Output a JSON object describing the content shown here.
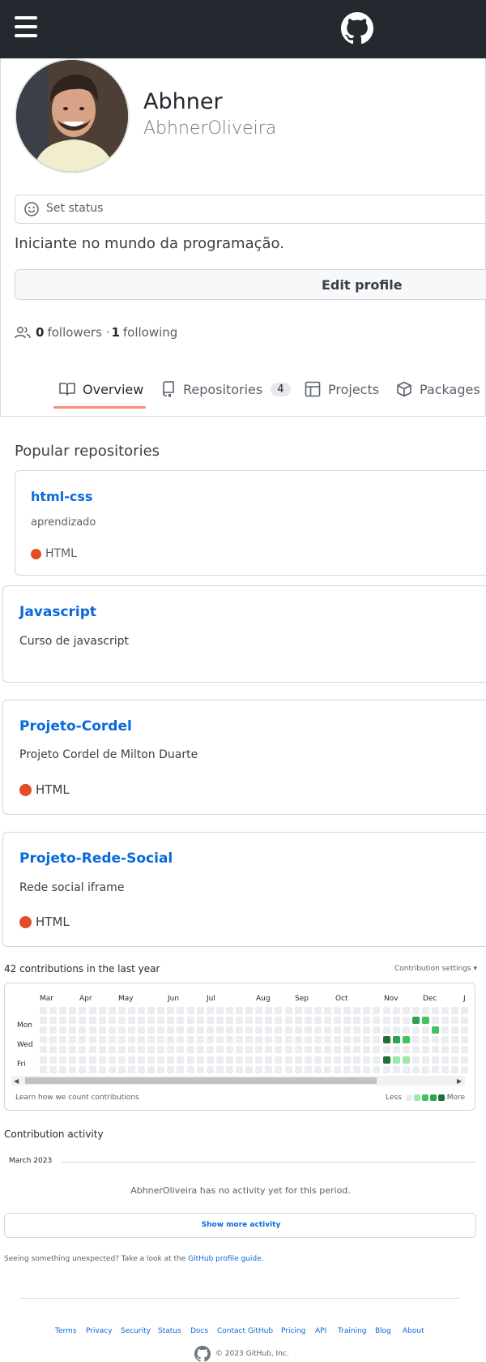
{
  "header": {
    "menu_icon": "hamburger-icon",
    "logo_icon": "github-mark-icon"
  },
  "profile": {
    "name": "Abhner",
    "login": "AbhnerOliveira",
    "status_label": "Set status",
    "bio": "Iniciante no mundo da programação.",
    "edit_label": "Edit profile",
    "followers_count": "0",
    "followers_label": "followers ·",
    "following_count": "1",
    "following_label": "following"
  },
  "tabs": [
    {
      "label": "Overview",
      "icon": "book-icon",
      "active": true
    },
    {
      "label": "Repositories",
      "icon": "repo-icon",
      "counter": "4"
    },
    {
      "label": "Projects",
      "icon": "table-icon"
    },
    {
      "label": "Packages",
      "icon": "package-icon"
    }
  ],
  "popular": {
    "title": "Popular repositories",
    "repos": [
      {
        "name": "html-css",
        "description": "aprendizado",
        "language": "HTML"
      },
      {
        "name": "Javascript",
        "description": "Curso de javascript",
        "language": ""
      },
      {
        "name": "Projeto-Cordel",
        "description": "Projeto Cordel de Milton Duarte",
        "language": "HTML"
      },
      {
        "name": "Projeto-Rede-Social",
        "description": "Rede social iframe",
        "language": "HTML"
      }
    ],
    "language_color": "#e34c26"
  },
  "contributions": {
    "summary": "42 contributions in the last year",
    "settings_label": "Contribution settings ▾",
    "months": [
      "Mar",
      "Apr",
      "May",
      "Jun",
      "Jul",
      "Aug",
      "Sep",
      "Oct",
      "Nov",
      "Dec",
      "J"
    ],
    "days": [
      "Mon",
      "Wed",
      "Fri"
    ],
    "learn_label": "Learn how we count contributions",
    "less_label": "Less",
    "more_label": "More",
    "level_colors": [
      "#ebedf0",
      "#9be9a8",
      "#40c463",
      "#30a14e",
      "#216e39"
    ]
  },
  "activity": {
    "title": "Contribution activity",
    "month": "March 2023",
    "empty_text": "AbhnerOliveira has no activity yet for this period.",
    "show_more": "Show more activity",
    "unexpected_text": "Seeing something unexpected? Take a look at the ",
    "guide_link": "GitHub profile guide."
  },
  "footer": {
    "links": [
      "Terms",
      "Privacy",
      "Security",
      "Status",
      "Docs",
      "Contact GitHub",
      "Pricing",
      "API",
      "Training",
      "Blog",
      "About"
    ],
    "copyright": "© 2023 GitHub, Inc."
  }
}
